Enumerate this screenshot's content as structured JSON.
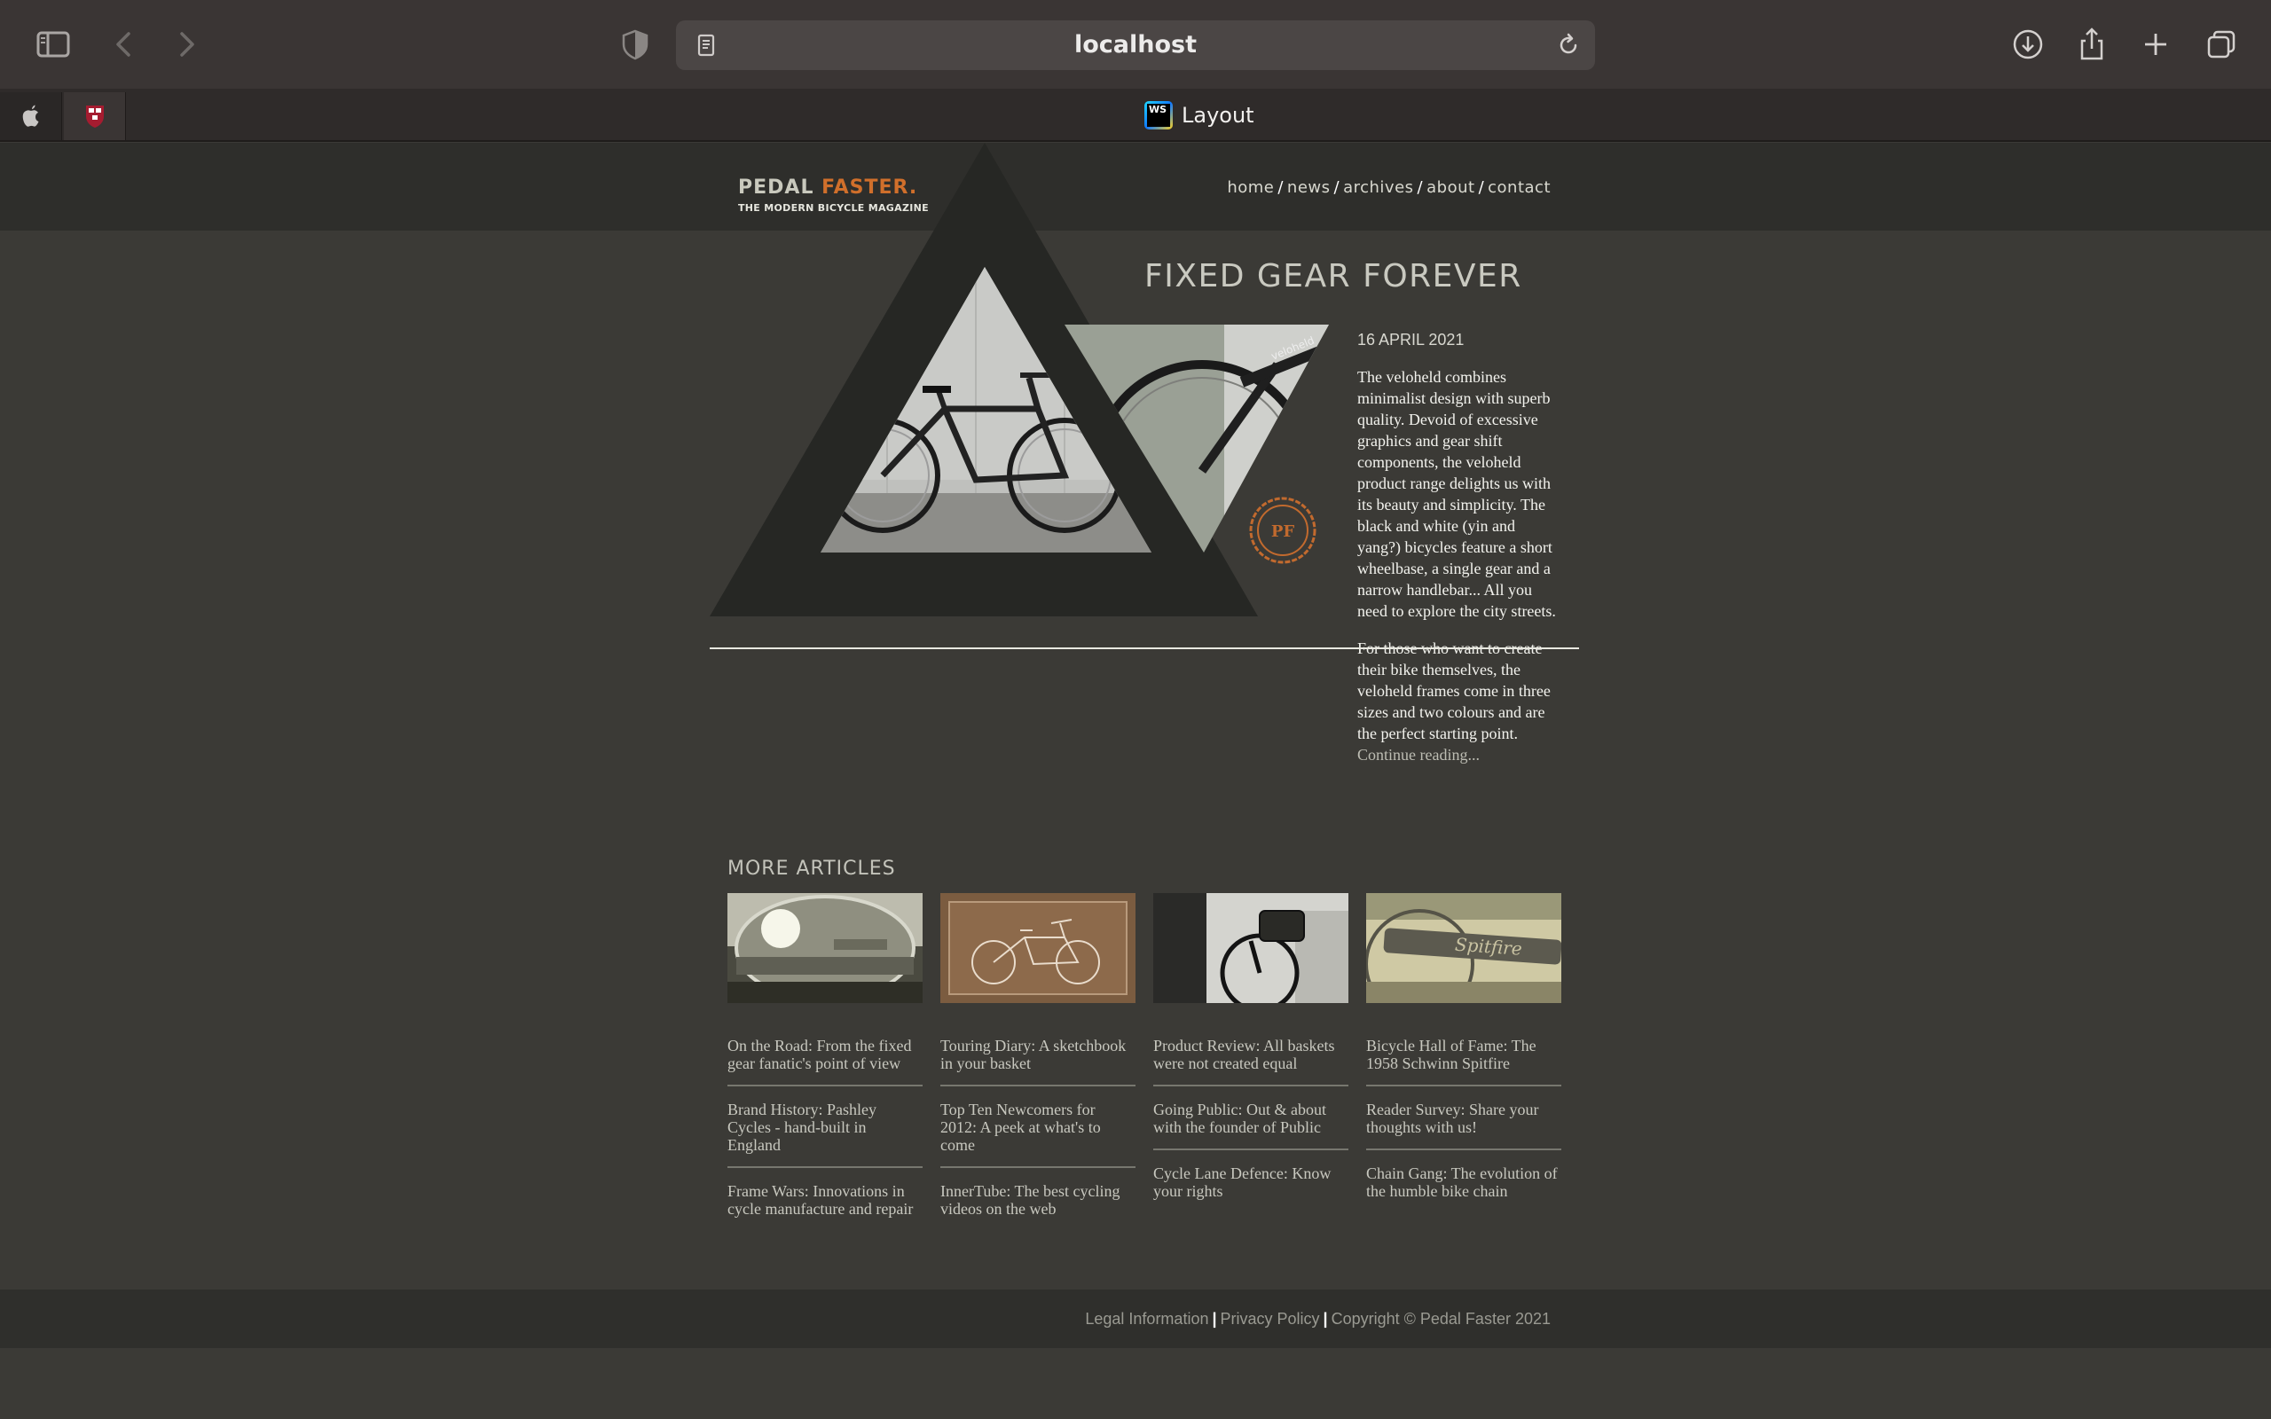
{
  "browser": {
    "url": "localhost",
    "tab_title": "Layout"
  },
  "site": {
    "logo_main": "PEDAL ",
    "logo_accent": "FASTER.",
    "logo_tagline": "THE MODERN BICYCLE MAGAZINE",
    "nav": [
      {
        "label": "home"
      },
      {
        "label": "news"
      },
      {
        "label": "archives"
      },
      {
        "label": "about"
      },
      {
        "label": "contact"
      }
    ],
    "badge": "PF"
  },
  "hero": {
    "title": "FIXED GEAR FOREVER",
    "date": "16 APRIL 2021",
    "paragraph1": "The veloheld combines minimalist design with superb quality. Devoid of excessive graphics and gear shift components, the veloheld product range delights us with its beauty and simplicity. The black and white (yin and yang?) bicycles feature a short wheelbase, a single gear and a narrow handlebar... All you need to explore the city streets.",
    "paragraph2": "For those who want to create their bike themselves, the veloheld frames come in three sizes and two colours and are the perfect starting point.",
    "continue_label": "Continue reading..."
  },
  "more_articles": {
    "heading": "MORE ARTICLES",
    "columns": [
      {
        "items": [
          "On the Road: From the fixed gear fanatic's point of view",
          "Brand History: Pashley Cycles - hand-built in England",
          "Frame Wars: Innovations in cycle manufacture and repair"
        ]
      },
      {
        "items": [
          "Touring Diary: A sketchbook in your basket",
          "Top Ten Newcomers for 2012: A peek at what's to come",
          "InnerTube: The best cycling videos on the web"
        ]
      },
      {
        "items": [
          "Product Review: All baskets were not created equal",
          "Going Public: Out & about with the founder of Public",
          "Cycle Lane Defence: Know your rights"
        ]
      },
      {
        "items": [
          "Bicycle Hall of Fame: The 1958 Schwinn Spitfire",
          "Reader Survey: Share your thoughts with us!",
          "Chain Gang: The evolution of the humble bike chain"
        ]
      }
    ]
  },
  "footer": {
    "legal": "Legal Information",
    "privacy": "Privacy Policy",
    "copyright": "Copyright © Pedal Faster 2021"
  },
  "colors": {
    "accent": "#d06f2b",
    "page_bg": "#3b3a36",
    "header_bg": "#2e2e2b"
  }
}
